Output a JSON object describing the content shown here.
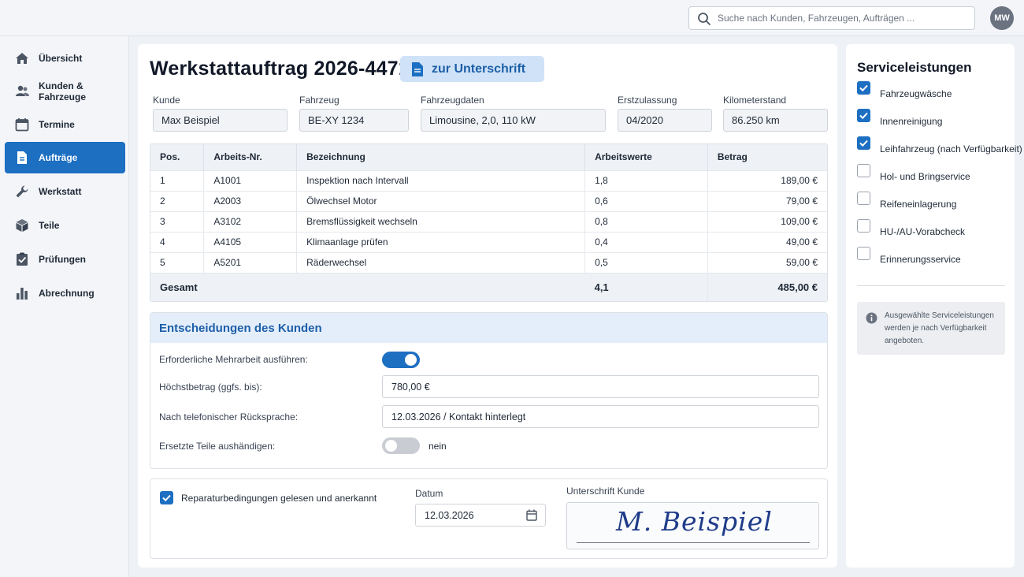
{
  "search": {
    "placeholder": "Suche nach Kunden, Fahrzeugen, Aufträgen ..."
  },
  "user": {
    "initials": "MW"
  },
  "sidebar": {
    "items": [
      {
        "label": "Übersicht",
        "icon": "home-icon",
        "active": false
      },
      {
        "label": "Kunden & Fahrzeuge",
        "icon": "users-icon",
        "active": false
      },
      {
        "label": "Termine",
        "icon": "calendar-icon",
        "active": false
      },
      {
        "label": "Aufträge",
        "icon": "document-icon",
        "active": true
      },
      {
        "label": "Werkstatt",
        "icon": "wrench-icon",
        "active": false
      },
      {
        "label": "Teile",
        "icon": "box-icon",
        "active": false
      },
      {
        "label": "Prüfungen",
        "icon": "checklist-icon",
        "active": false
      },
      {
        "label": "Abrechnung",
        "icon": "bar-chart-icon",
        "active": false
      }
    ]
  },
  "order": {
    "title": "Werkstattauftrag 2026-4471",
    "signature_button": "zur Unterschrift"
  },
  "fields": {
    "kunde": {
      "label": "Kunde",
      "value": "Max Beispiel"
    },
    "fahrzeug": {
      "label": "Fahrzeug",
      "value": "BE-XY 1234"
    },
    "fahrzeugdaten": {
      "label": "Fahrzeugdaten",
      "value": "Limousine, 2,0, 110 kW"
    },
    "erstzulassung": {
      "label": "Erstzulassung",
      "value": "04/2020"
    },
    "kilometerstand": {
      "label": "Kilometerstand",
      "value": "86.250 km"
    }
  },
  "table": {
    "headers": [
      "Pos.",
      "Arbeits-Nr.",
      "Bezeichnung",
      "Arbeitswerte",
      "Betrag"
    ],
    "rows": [
      [
        "1",
        "A1001",
        "Inspektion nach Intervall",
        "1,8",
        "189,00 €"
      ],
      [
        "2",
        "A2003",
        "Ölwechsel Motor",
        "0,6",
        "79,00 €"
      ],
      [
        "3",
        "A3102",
        "Bremsflüssigkeit wechseln",
        "0,8",
        "109,00 €"
      ],
      [
        "4",
        "A4105",
        "Klimaanlage prüfen",
        "0,4",
        "49,00 €"
      ],
      [
        "5",
        "A5201",
        "Räderwechsel",
        "0,5",
        "59,00 €"
      ]
    ],
    "total_label": "Gesamt",
    "total_aw": "4,1",
    "total_amount": "485,00 €"
  },
  "decisions": {
    "title": "Entscheidungen des Kunden",
    "mehrarbeit_label": "Erforderliche Mehrarbeit ausführen:",
    "mehrarbeit_on": true,
    "hoechstbetrag_label": "Höchstbetrag (ggfs. bis):",
    "hoechstbetrag_value": "780,00 €",
    "ruecksprache_label": "Nach telefonischer Rücksprache:",
    "ruecksprache_value": "12.03.2026 / Kontakt hinterlegt",
    "teile_label": "Ersetzte Teile aushändigen:",
    "teile_on": false,
    "teile_value": "nein"
  },
  "confirmation": {
    "terms_label": "Reparaturbedingungen gelesen und anerkannt",
    "terms_checked": true,
    "date_label": "Datum",
    "date_value": "12.03.2026",
    "signature_label": "Unterschrift Kunde",
    "signature_text": "M. Beispiel"
  },
  "services": {
    "title": "Serviceleistungen",
    "items": [
      {
        "label": "Fahrzeugwäsche",
        "checked": true
      },
      {
        "label": "Innenreinigung",
        "checked": true
      },
      {
        "label": "Leihfahrzeug (nach Verfügbarkeit)",
        "checked": true
      },
      {
        "label": "Hol- und Bringservice",
        "checked": false
      },
      {
        "label": "Reifeneinlagerung",
        "checked": false
      },
      {
        "label": "HU-/AU-Vorabcheck",
        "checked": false
      },
      {
        "label": "Erinnerungsservice",
        "checked": false
      }
    ],
    "info": "Ausgewählte Serviceleistungen werden je nach Verfügbarkeit angeboten."
  },
  "colors": {
    "accent": "#1d6fc2",
    "accent_light": "#cfe2f7",
    "signature_ink": "#1f3c8a"
  }
}
